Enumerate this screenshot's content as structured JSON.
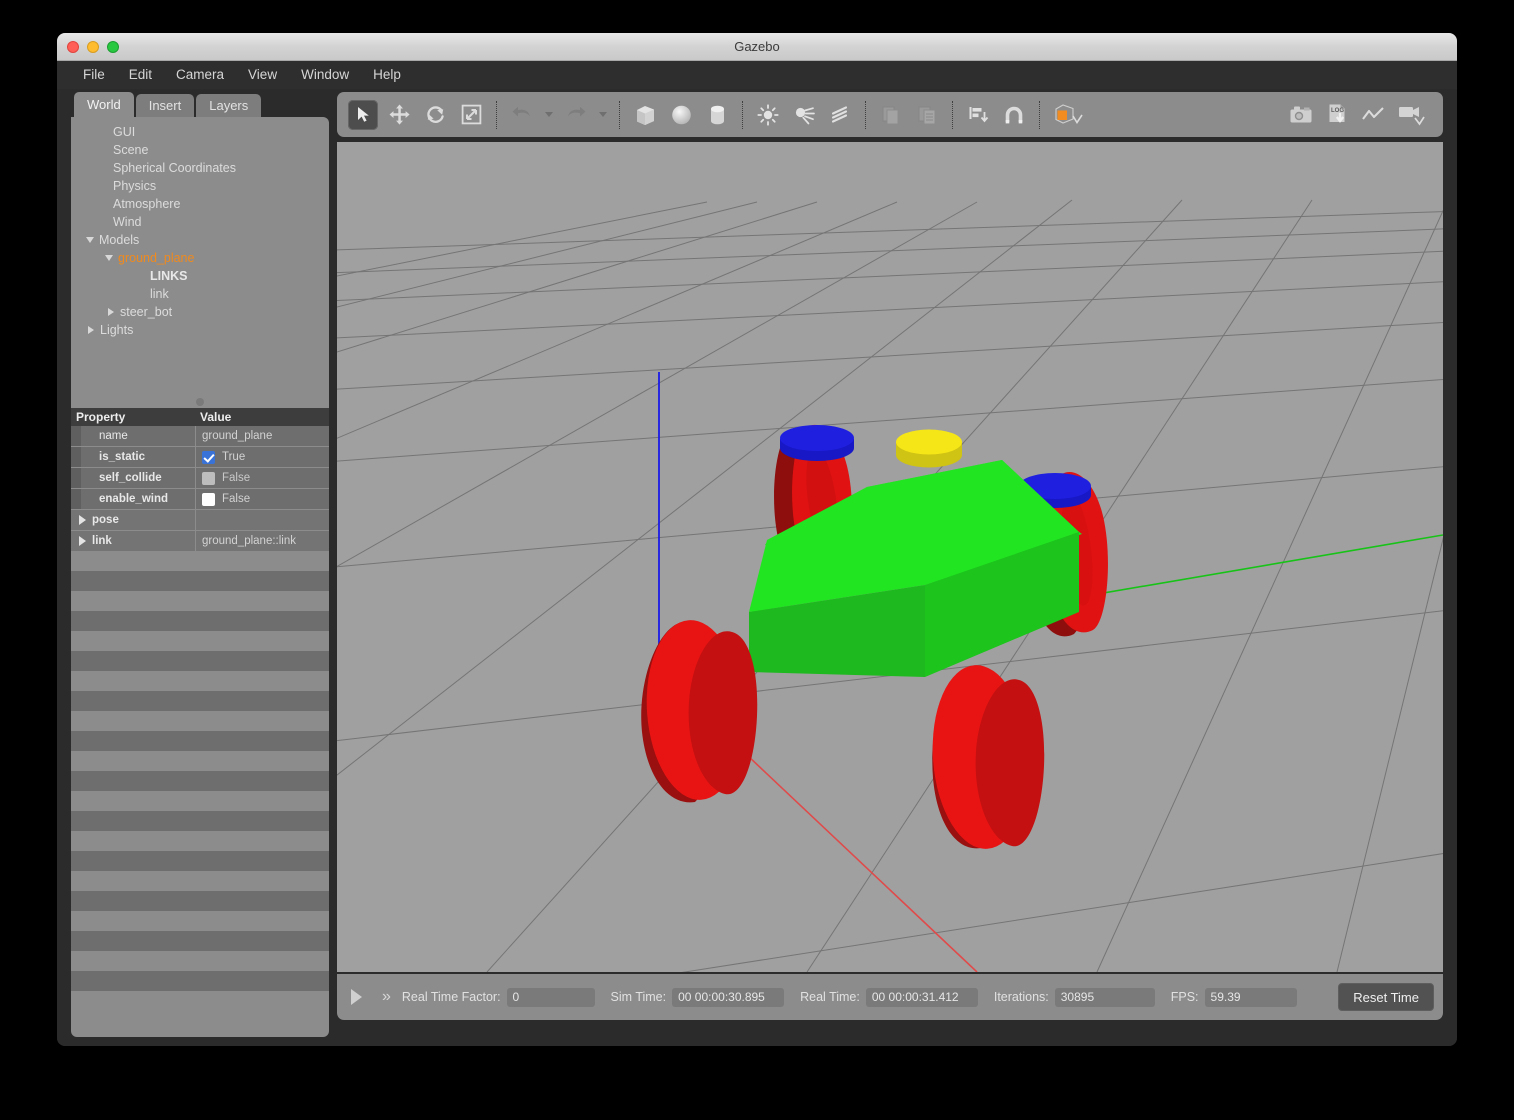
{
  "window": {
    "title": "Gazebo",
    "traffic": [
      "close-button",
      "minimize-button",
      "zoom-button"
    ]
  },
  "menubar": {
    "items": [
      {
        "label": "File"
      },
      {
        "label": "Edit"
      },
      {
        "label": "Camera"
      },
      {
        "label": "View"
      },
      {
        "label": "Window"
      },
      {
        "label": "Help"
      }
    ]
  },
  "left_panel": {
    "tabs": [
      {
        "label": "World",
        "active": true
      },
      {
        "label": "Insert",
        "active": false
      },
      {
        "label": "Layers",
        "active": false
      }
    ],
    "tree": [
      {
        "label": "GUI",
        "depth": 1,
        "arrow": "none",
        "style": "normal"
      },
      {
        "label": "Scene",
        "depth": 1,
        "arrow": "none",
        "style": "normal"
      },
      {
        "label": "Spherical Coordinates",
        "depth": 1,
        "arrow": "none",
        "style": "normal"
      },
      {
        "label": "Physics",
        "depth": 1,
        "arrow": "none",
        "style": "normal"
      },
      {
        "label": "Atmosphere",
        "depth": 1,
        "arrow": "none",
        "style": "normal"
      },
      {
        "label": "Wind",
        "depth": 1,
        "arrow": "none",
        "style": "normal"
      },
      {
        "label": "Models",
        "depth": 1,
        "arrow": "down",
        "style": "normal"
      },
      {
        "label": "ground_plane",
        "depth": 2,
        "arrow": "down",
        "style": "selected"
      },
      {
        "label": "LINKS",
        "depth": 3,
        "arrow": "none",
        "style": "bold"
      },
      {
        "label": "link",
        "depth": 3,
        "arrow": "none",
        "style": "normal"
      },
      {
        "label": "steer_bot",
        "depth": 2,
        "arrow": "right",
        "style": "normal"
      },
      {
        "label": "Lights",
        "depth": 1,
        "arrow": "right",
        "style": "normal"
      }
    ],
    "property_table": {
      "headers": [
        "Property",
        "Value"
      ],
      "rows": [
        {
          "name": "name",
          "bold": false,
          "expandable": false,
          "value_type": "text",
          "value": "ground_plane"
        },
        {
          "name": "is_static",
          "bold": true,
          "expandable": false,
          "value_type": "checkbox",
          "checkbox": "checked",
          "value": "True"
        },
        {
          "name": "self_collide",
          "bold": true,
          "expandable": false,
          "value_type": "checkbox",
          "checkbox": "grey",
          "value": "False"
        },
        {
          "name": "enable_wind",
          "bold": true,
          "expandable": false,
          "value_type": "checkbox",
          "checkbox": "white",
          "value": "False"
        },
        {
          "name": "pose",
          "bold": true,
          "expandable": true,
          "value_type": "text",
          "value": ""
        },
        {
          "name": "link",
          "bold": true,
          "expandable": true,
          "value_type": "text",
          "value": "ground_plane::link"
        }
      ],
      "empty_row_count": 11
    }
  },
  "toolbar": {
    "groups": [
      {
        "buttons": [
          {
            "name": "select-mode-button",
            "icon": "arrow-cursor-icon",
            "active": true,
            "enabled": true
          },
          {
            "name": "translate-mode-button",
            "icon": "move-arrows-icon",
            "active": false,
            "enabled": true
          },
          {
            "name": "rotate-mode-button",
            "icon": "rotate-icon",
            "active": false,
            "enabled": true
          },
          {
            "name": "scale-mode-button",
            "icon": "scale-icon",
            "active": false,
            "enabled": true
          }
        ]
      },
      {
        "buttons": [
          {
            "name": "undo-button",
            "icon": "undo-arrow-icon",
            "active": false,
            "enabled": false,
            "caret": true
          },
          {
            "name": "redo-button",
            "icon": "redo-arrow-icon",
            "active": false,
            "enabled": false,
            "caret": true
          }
        ]
      },
      {
        "buttons": [
          {
            "name": "insert-box-button",
            "icon": "box-icon",
            "active": false,
            "enabled": true
          },
          {
            "name": "insert-sphere-button",
            "icon": "sphere-icon",
            "active": false,
            "enabled": true
          },
          {
            "name": "insert-cylinder-button",
            "icon": "cylinder-icon",
            "active": false,
            "enabled": true
          }
        ]
      },
      {
        "buttons": [
          {
            "name": "point-light-button",
            "icon": "point-light-icon",
            "active": false,
            "enabled": true
          },
          {
            "name": "spot-light-button",
            "icon": "spot-light-icon",
            "active": false,
            "enabled": true
          },
          {
            "name": "directional-light-button",
            "icon": "directional-light-icon",
            "active": false,
            "enabled": true
          }
        ]
      },
      {
        "buttons": [
          {
            "name": "copy-button",
            "icon": "copy-icon",
            "active": false,
            "enabled": false
          },
          {
            "name": "paste-button",
            "icon": "paste-icon",
            "active": false,
            "enabled": false
          }
        ]
      },
      {
        "buttons": [
          {
            "name": "align-button",
            "icon": "align-icon",
            "active": false,
            "enabled": true
          },
          {
            "name": "snap-button",
            "icon": "magnet-icon",
            "active": false,
            "enabled": true
          }
        ]
      },
      {
        "buttons": [
          {
            "name": "change-view-button",
            "icon": "view-cube-icon",
            "active": false,
            "enabled": true
          }
        ]
      }
    ],
    "right_buttons": [
      {
        "name": "screenshot-button",
        "icon": "camera-icon"
      },
      {
        "name": "log-data-button",
        "icon": "log-download-icon"
      },
      {
        "name": "plot-button",
        "icon": "plot-line-icon"
      },
      {
        "name": "record-video-button",
        "icon": "video-camera-icon"
      }
    ]
  },
  "viewport": {
    "scene_name": "3d-render-view",
    "background_color": "#a0a0a0",
    "grid_color": "#6f6f6f",
    "axes": {
      "x_axis_color": "#e05050",
      "y_axis_color": "#19c419",
      "z_axis_color": "#1414ee"
    },
    "model": {
      "name": "steer_bot",
      "chassis_color": "#19e219",
      "chassis_side_color": "#15b415",
      "wheel_color": "#e81414",
      "wheel_shadow_color": "#9e0d0d",
      "steer_cap_color": "#1f1fd6",
      "sensor_color": "#f0e21a"
    }
  },
  "statusbar": {
    "play_button_label": "play",
    "step_button_label": "step",
    "fields": [
      {
        "label": "Real Time Factor:",
        "value": "0"
      },
      {
        "label": "Sim Time:",
        "value": "00 00:00:30.895"
      },
      {
        "label": "Real Time:",
        "value": "00 00:00:31.412"
      },
      {
        "label": "Iterations:",
        "value": "30895"
      },
      {
        "label": "FPS:",
        "value": "59.39"
      }
    ],
    "reset_button": "Reset Time"
  }
}
